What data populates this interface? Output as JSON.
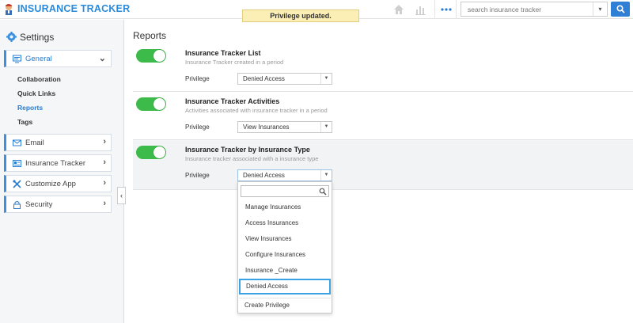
{
  "app": {
    "title": "INSURANCE TRACKER",
    "accent": "#2a8bdc"
  },
  "toast": {
    "message": "Privilege updated."
  },
  "toolbar": {
    "icons": [
      "home-icon",
      "bar-chart-icon",
      "more-dots-icon"
    ],
    "search_placeholder": "search insurance tracker",
    "search_caret": "▾"
  },
  "sidebar": {
    "title": "Settings",
    "groups": [
      {
        "label": "General",
        "icon": "monitor-icon",
        "chevron": "⌄"
      },
      {
        "label": "Email",
        "icon": "envelope-icon",
        "chevron": "›"
      },
      {
        "label": "Insurance Tracker",
        "icon": "card-icon",
        "chevron": "›"
      },
      {
        "label": "Customize App",
        "icon": "tools-icon",
        "chevron": "›"
      },
      {
        "label": "Security",
        "icon": "lock-icon",
        "chevron": "›"
      }
    ],
    "sub_items": [
      "Collaboration",
      "Quick Links",
      "Reports",
      "Tags"
    ],
    "collapse_glyph": "‹"
  },
  "main": {
    "title": "Reports",
    "reports": [
      {
        "title": "Insurance Tracker List",
        "description": "Insurance Tracker created in a period",
        "privilege_label": "Privilege",
        "privilege_value": "Denied Access",
        "enabled": true
      },
      {
        "title": "Insurance Tracker Activities",
        "description": "Activities associated with insurance tracker in a period",
        "privilege_label": "Privilege",
        "privilege_value": "View Insurances",
        "enabled": true
      },
      {
        "title": "Insurance Tracker by Insurance Type",
        "description": "Insurance tracker associated with a insurance type",
        "privilege_label": "Privilege",
        "privilege_value": "Denied Access",
        "enabled": true
      }
    ]
  },
  "dropdown": {
    "options": [
      "Manage Insurances",
      "Access Insurances",
      "View Insurances",
      "Configure Insurances",
      "Insurance _Create",
      "Denied Access"
    ],
    "selected": "Denied Access",
    "create_label": "Create Privilege"
  },
  "colors": {
    "toggle_on": "#3cba4a",
    "highlight": "#39a3e6",
    "toast_bg": "#fbefb5"
  }
}
